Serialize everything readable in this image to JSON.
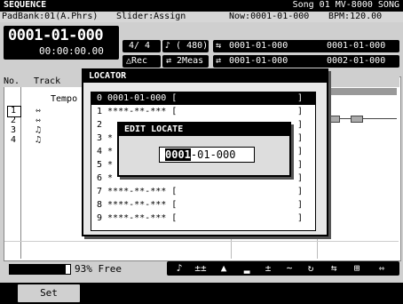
{
  "header": {
    "title": "SEQUENCE",
    "song": "Song 01 MV-8000 SONG"
  },
  "info": {
    "padbank": "PadBank:01(A.Phrs)",
    "slider": "Slider:Assign",
    "now": "Now:0001-01-000",
    "bpm": "BPM:120.00"
  },
  "position": {
    "measure": "0001-01-000",
    "time": "00:00:00.00",
    "time_sig": "4/ 4",
    "quantize": "♪ ( 480)",
    "rec": "△Rec",
    "loop": "⇄ 2Meas",
    "loop1_start": "0001-01-000",
    "loop1_end": "0001-01-000",
    "loop2_start": "0001-01-000",
    "loop2_end": "0002-01-000"
  },
  "track_list": {
    "col_no": "No.",
    "col_track": "Track",
    "tempo_label": "Tempo",
    "rows": [
      {
        "no": "1",
        "icon": "⇿"
      },
      {
        "no": "2",
        "icon": "⇿"
      },
      {
        "no": "3",
        "icon": "♫"
      },
      {
        "no": "4",
        "icon": "♫"
      }
    ]
  },
  "locator": {
    "title": "LOCATOR",
    "items": [
      {
        "label": "0 0001-01-000 [",
        "end": "]"
      },
      {
        "label": "1 ****-**-*** [",
        "end": "]"
      },
      {
        "label": "2 ",
        "end": "]"
      },
      {
        "label": "3 *",
        "end": "]"
      },
      {
        "label": "4 *",
        "end": "]"
      },
      {
        "label": "5 *",
        "end": "]"
      },
      {
        "label": "6 *",
        "end": "]"
      },
      {
        "label": "7 ****-**-*** [",
        "end": "]"
      },
      {
        "label": "8 ****-**-*** [",
        "end": "]"
      },
      {
        "label": "9 ****-**-*** [",
        "end": "]"
      }
    ]
  },
  "edit_locate": {
    "title": "EDIT LOCATE",
    "value_cursor": "0001",
    "value_rest": "-01-000"
  },
  "memory": {
    "percent_free": 93,
    "label": "93% Free"
  },
  "bottom_icons": [
    {
      "name": "note-icon",
      "glyph": "♪"
    },
    {
      "name": "step-icon",
      "glyph": "±±"
    },
    {
      "name": "up-icon",
      "glyph": "▲"
    },
    {
      "name": "step-down-icon",
      "glyph": "▂"
    },
    {
      "name": "plusminus-icon",
      "glyph": "±"
    },
    {
      "name": "wave-icon",
      "glyph": "∼"
    },
    {
      "name": "loop-icon",
      "glyph": "↻"
    },
    {
      "name": "shuffle-icon",
      "glyph": "⇆"
    },
    {
      "name": "grid-icon",
      "glyph": "⊞"
    },
    {
      "name": "marker-icon",
      "glyph": "⇿"
    }
  ],
  "fkeys": {
    "set": "Set"
  }
}
